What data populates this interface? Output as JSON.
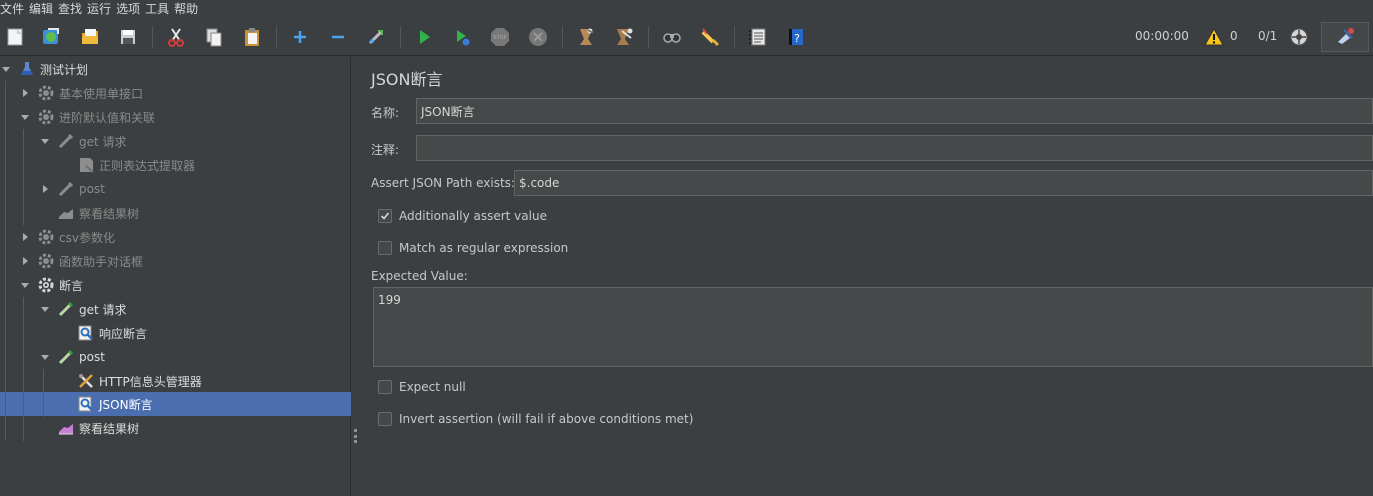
{
  "menu": [
    "文件",
    "编辑",
    "查找",
    "运行",
    "选项",
    "工具",
    "帮助"
  ],
  "toolbar": {
    "timer": "00:00:00",
    "warnings": "0",
    "threads": "0/1",
    "icons": [
      "new-icon",
      "templates-icon",
      "open-icon",
      "save-icon",
      "cut-icon",
      "copy-icon",
      "paste-icon",
      "expand-icon",
      "collapse-icon",
      "toggle-icon",
      "start-icon",
      "start-no-pause-icon",
      "stop-icon",
      "shutdown-icon",
      "clear-icon",
      "clear-all-icon",
      "search-icon",
      "reset-search-icon",
      "function-helper-icon",
      "help-icon",
      "warning-icon",
      "remote-icon",
      "log-viewer-icon"
    ]
  },
  "tree": {
    "items": [
      {
        "label": "测试计划",
        "icon": "flask-icon"
      },
      {
        "label": "基本使用单接口",
        "icon": "gear-icon"
      },
      {
        "label": "进阶默认值和关联",
        "icon": "gear-icon"
      },
      {
        "label": "get 请求",
        "icon": "pipette-icon"
      },
      {
        "label": "正则表达式提取器",
        "icon": "extractor-icon"
      },
      {
        "label": "post",
        "icon": "pipette-icon"
      },
      {
        "label": "察看结果树",
        "icon": "chart-icon"
      },
      {
        "label": "csv参数化",
        "icon": "gear-icon"
      },
      {
        "label": "函数助手对话框",
        "icon": "gear-icon"
      },
      {
        "label": "断言",
        "icon": "gear-icon"
      },
      {
        "label": "get 请求",
        "icon": "pipette-icon"
      },
      {
        "label": "响应断言",
        "icon": "assertion-icon"
      },
      {
        "label": "post",
        "icon": "pipette-icon"
      },
      {
        "label": "HTTP信息头管理器",
        "icon": "tools-icon"
      },
      {
        "label": "JSON断言",
        "icon": "assertion-icon"
      },
      {
        "label": "察看结果树",
        "icon": "chart-icon"
      }
    ]
  },
  "panel": {
    "title": "JSON断言",
    "name_label": "名称:",
    "name_value": "JSON断言",
    "comment_label": "注释:",
    "comment_value": "",
    "path_label": "Assert JSON Path exists:",
    "path_value": "$.code",
    "additionally_label": "Additionally assert value",
    "additionally_checked": true,
    "regex_label": "Match as regular expression",
    "regex_checked": false,
    "expected_label": "Expected Value:",
    "expected_value": "199",
    "expect_null_label": "Expect null",
    "expect_null_checked": false,
    "invert_label": "Invert assertion (will fail if above conditions met)",
    "invert_checked": false
  }
}
